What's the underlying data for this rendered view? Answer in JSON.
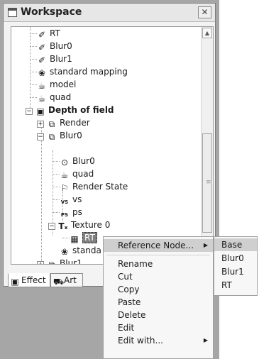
{
  "window": {
    "title": "Workspace",
    "close_glyph": "✕"
  },
  "tree": {
    "nodes": [
      {
        "label": "RT",
        "icon": "pencil-icon",
        "glyph": "✐"
      },
      {
        "label": "Blur0",
        "icon": "pencil-icon",
        "glyph": "✐"
      },
      {
        "label": "Blur1",
        "icon": "pencil-icon",
        "glyph": "✐"
      },
      {
        "label": "standard mapping",
        "icon": "sphere-mapping-icon",
        "glyph": "❀"
      },
      {
        "label": "model",
        "icon": "teapot-icon",
        "glyph": "☕"
      },
      {
        "label": "quad",
        "icon": "teapot-icon",
        "glyph": "☕"
      },
      {
        "label": "Depth of field",
        "icon": "effect-folder-icon",
        "glyph": "▣",
        "expander": "−"
      },
      {
        "label": "Render",
        "icon": "render-pass-icon",
        "glyph": "⧉",
        "expander": "+"
      },
      {
        "label": "Blur0",
        "icon": "render-pass-icon",
        "glyph": "⧉",
        "expander": "−"
      },
      {
        "label": "Blur0",
        "icon": "target-icon",
        "glyph": "⊙"
      },
      {
        "label": "quad",
        "icon": "model-ref-icon",
        "glyph": "☕"
      },
      {
        "label": "Render State",
        "icon": "flag-icon",
        "glyph": "⚐"
      },
      {
        "label": "vs",
        "icon": "vertex-shader-icon",
        "glyph": "VS"
      },
      {
        "label": "ps",
        "icon": "pixel-shader-icon",
        "glyph": "PS"
      },
      {
        "label": "Texture 0",
        "icon": "texture-icon",
        "glyph": "Tₓ",
        "expander": "−"
      },
      {
        "label": "RT",
        "icon": "render-target-icon",
        "glyph": "▦"
      },
      {
        "label": "standa",
        "icon": "sphere-mapping-icon",
        "glyph": "❀"
      },
      {
        "label": "Blur1",
        "icon": "render-pass-icon",
        "glyph": "⧉",
        "expander": "+"
      }
    ]
  },
  "scrollbar": {
    "up": "▲",
    "down": "▼",
    "grip": "≡"
  },
  "tabs": [
    {
      "label": "Effect",
      "icon": "effect-tab-icon",
      "glyph": "▣"
    },
    {
      "label": "Art",
      "icon": "art-tab-icon",
      "glyph": "⛟"
    }
  ],
  "context_menu": {
    "items": [
      "Reference Node...",
      "Rename",
      "Cut",
      "Copy",
      "Paste",
      "Delete",
      "Edit",
      "Edit with..."
    ],
    "submenu_glyph": "▶"
  },
  "submenu": {
    "items": [
      "Base",
      "Blur0",
      "Blur1",
      "RT"
    ]
  }
}
